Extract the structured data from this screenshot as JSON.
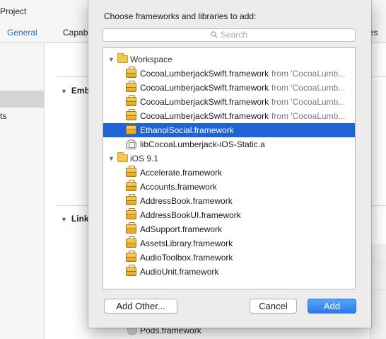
{
  "background": {
    "project_label": "Project",
    "tabs": [
      "General",
      "Capab",
      "ases"
    ],
    "left_item": "ts",
    "sections": [
      "Emb",
      "Link"
    ],
    "pods_item": "Pods.framework",
    "accent_color": "#2d6ec9"
  },
  "sheet": {
    "title": "Choose frameworks and libraries to add:",
    "search": {
      "placeholder": "Search",
      "value": ""
    },
    "groups": [
      {
        "label": "Workspace",
        "items": [
          {
            "name": "CocoaLumberjackSwift.framework",
            "from": "from 'CocoaLumb...",
            "icon": "framework-icon",
            "selected": false
          },
          {
            "name": "CocoaLumberjackSwift.framework",
            "from": "from 'CocoaLumb...",
            "icon": "framework-icon",
            "selected": false
          },
          {
            "name": "CocoaLumberjackSwift.framework",
            "from": "from 'CocoaLumb...",
            "icon": "framework-icon",
            "selected": false
          },
          {
            "name": "CocoaLumberjackSwift.framework",
            "from": "from 'CocoaLumb...",
            "icon": "framework-icon",
            "selected": false
          },
          {
            "name": "EthanolSocial.framework",
            "from": "",
            "icon": "framework-icon",
            "selected": true
          },
          {
            "name": "libCocoaLumberjack-iOS-Static.a",
            "from": "",
            "icon": "library-icon",
            "selected": false
          }
        ]
      },
      {
        "label": "iOS 9.1",
        "items": [
          {
            "name": "Accelerate.framework",
            "from": "",
            "icon": "framework-icon",
            "selected": false
          },
          {
            "name": "Accounts.framework",
            "from": "",
            "icon": "framework-icon",
            "selected": false
          },
          {
            "name": "AddressBook.framework",
            "from": "",
            "icon": "framework-icon",
            "selected": false
          },
          {
            "name": "AddressBookUI.framework",
            "from": "",
            "icon": "framework-icon",
            "selected": false
          },
          {
            "name": "AdSupport.framework",
            "from": "",
            "icon": "framework-icon",
            "selected": false
          },
          {
            "name": "AssetsLibrary.framework",
            "from": "",
            "icon": "framework-icon",
            "selected": false
          },
          {
            "name": "AudioToolbox.framework",
            "from": "",
            "icon": "framework-icon",
            "selected": false
          },
          {
            "name": "AudioUnit.framework",
            "from": "",
            "icon": "framework-icon",
            "selected": false
          }
        ]
      }
    ],
    "buttons": {
      "add_other": "Add Other...",
      "cancel": "Cancel",
      "add": "Add"
    },
    "selection_color": "#1f64d4",
    "primary_color": "#2a7bef"
  }
}
